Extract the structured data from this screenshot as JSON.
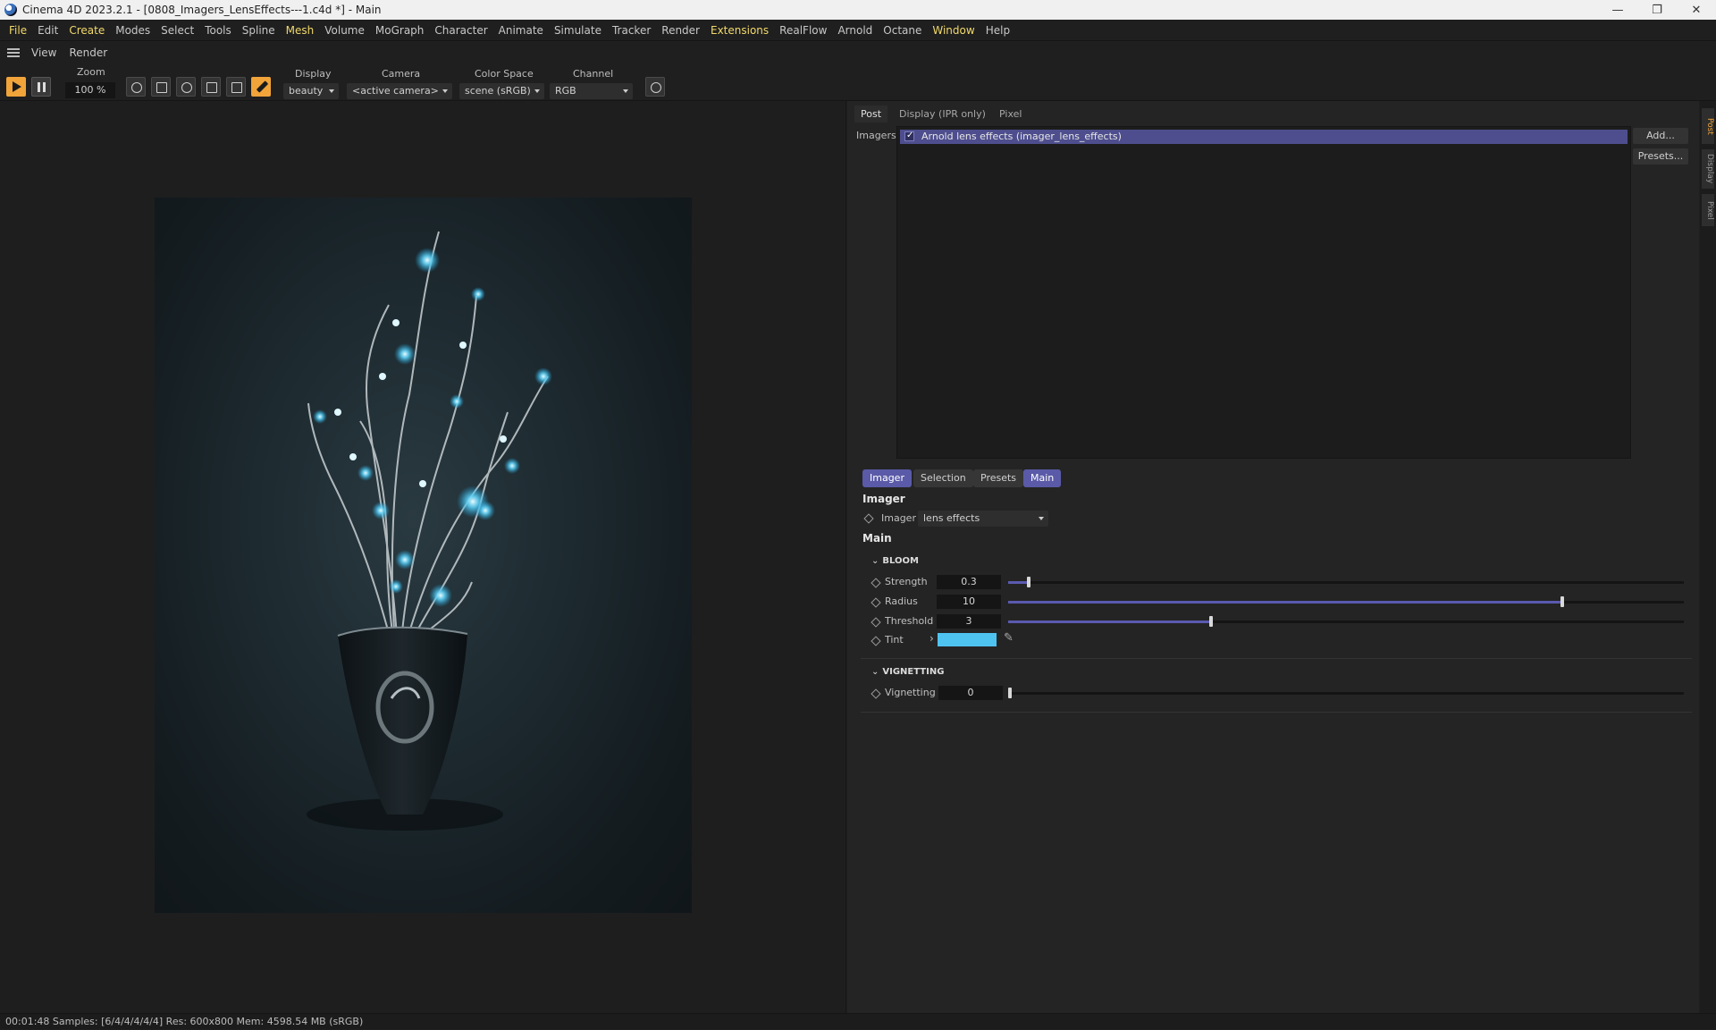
{
  "window": {
    "title": "Cinema 4D 2023.2.1 - [0808_Imagers_LensEffects---1.c4d *] - Main",
    "min_symbol": "—",
    "restore_symbol": "❐",
    "close_symbol": "✕"
  },
  "menu": [
    "File",
    "Edit",
    "Create",
    "Modes",
    "Select",
    "Tools",
    "Spline",
    "Mesh",
    "Volume",
    "MoGraph",
    "Character",
    "Animate",
    "Simulate",
    "Tracker",
    "Render",
    "Extensions",
    "RealFlow",
    "Arnold",
    "Octane",
    "Window",
    "Help"
  ],
  "viewmenu": {
    "view": "View",
    "render": "Render"
  },
  "toolbar": {
    "zoom_label": "Zoom",
    "zoom_value": "100 %",
    "display_label": "Display",
    "display_value": "beauty",
    "camera_label": "Camera",
    "camera_value": "<active camera>",
    "colorspace_label": "Color Space",
    "colorspace_value": "scene (sRGB)",
    "channel_label": "Channel",
    "channel_value": "RGB"
  },
  "panel": {
    "tabs": [
      "Post",
      "Display (IPR only)",
      "Pixel"
    ],
    "imagers_label": "Imagers",
    "imager_item": "Arnold lens effects (imager_lens_effects)",
    "add_button": "Add...",
    "presets_button": "Presets...",
    "subtabs": [
      "Imager",
      "Selection",
      "Presets",
      "Main"
    ],
    "imager_heading": "Imager",
    "imager_field_label": "Imager",
    "imager_field_value": "lens effects",
    "main_heading": "Main",
    "bloom_section": "BLOOM",
    "strength": {
      "label": "Strength",
      "value": "0.3",
      "fraction": 0.03
    },
    "radius": {
      "label": "Radius",
      "value": "10",
      "fraction": 0.82
    },
    "threshold": {
      "label": "Threshold",
      "value": "3",
      "fraction": 0.3
    },
    "tint": {
      "label": "Tint",
      "color": "#4fc3f0"
    },
    "vignetting_section": "VIGNETTING",
    "vignetting": {
      "label": "Vignetting",
      "value": "0",
      "fraction": 0.0
    }
  },
  "sidebar_tabs": [
    "Post",
    "Display",
    "Pixel"
  ],
  "status": "00:01:48  Samples: [6/4/4/4/4/4]  Res: 600x800  Mem: 4598.54 MB  (sRGB)",
  "colors": {
    "accent": "#5a5ab0",
    "play": "#f0a43a",
    "tint": "#4fc3f0",
    "highlight_menu": "#f2d96a"
  }
}
